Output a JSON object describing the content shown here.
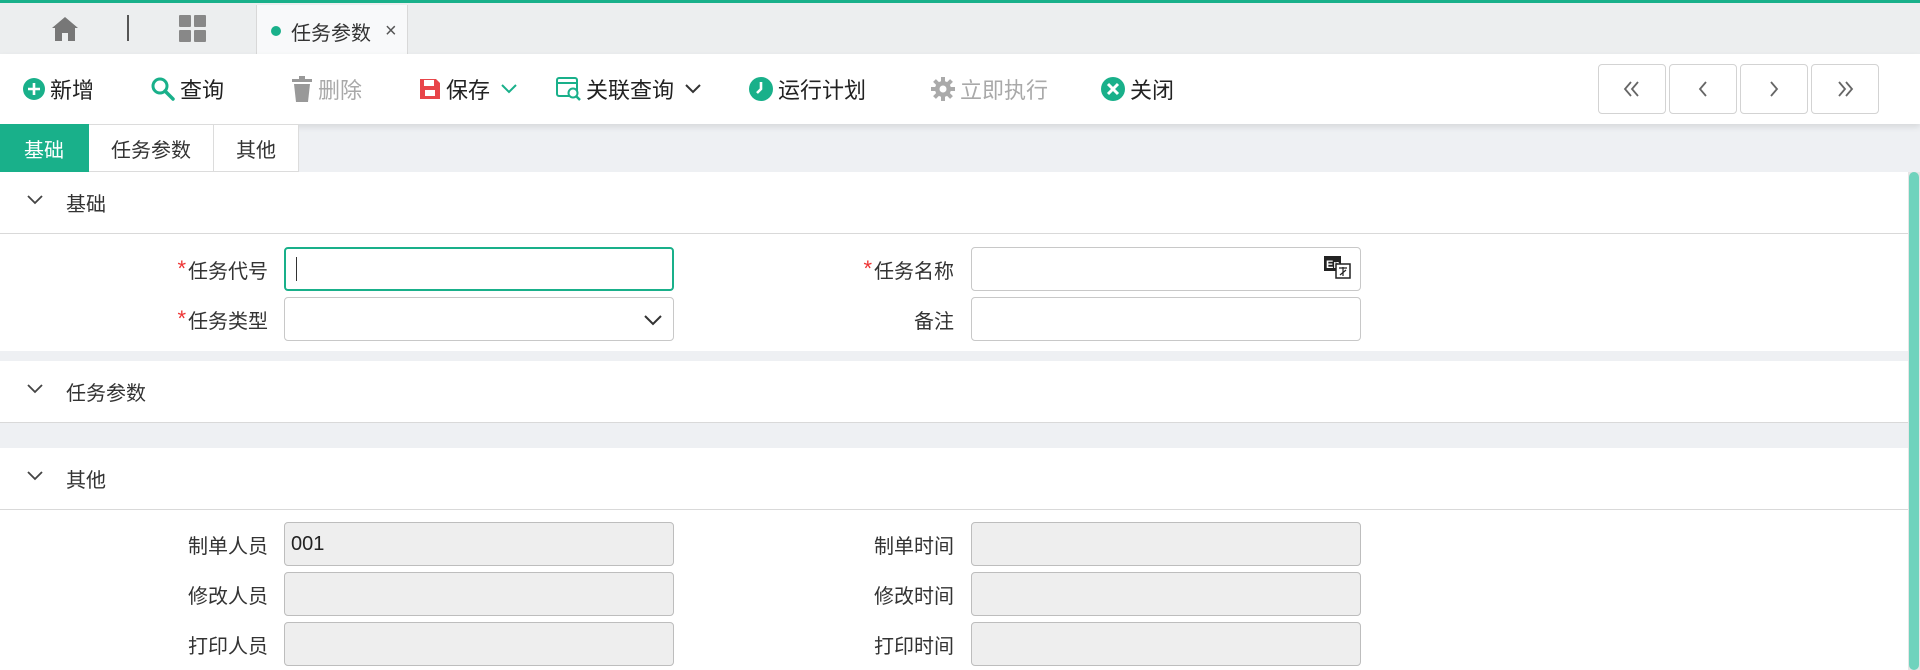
{
  "topbar": {
    "tab_label": "任务参数",
    "close_symbol": "×"
  },
  "toolbar": {
    "add": "新增",
    "query": "查询",
    "delete": "删除",
    "save": "保存",
    "related_query": "关联查询",
    "run_plan": "运行计划",
    "execute_now": "立即执行",
    "close": "关闭"
  },
  "subtabs": [
    "基础",
    "任务参数",
    "其他"
  ],
  "sections": {
    "basic": {
      "title": "基础",
      "task_code_label": "任务代号",
      "task_name_label": "任务名称",
      "task_type_label": "任务类型",
      "remark_label": "备注",
      "task_code_value": "",
      "task_name_value": "",
      "task_type_value": "",
      "remark_value": ""
    },
    "params": {
      "title": "任务参数"
    },
    "other": {
      "title": "其他",
      "creator_label": "制单人员",
      "creator_value": "001",
      "create_time_label": "制单时间",
      "create_time_value": "",
      "modifier_label": "修改人员",
      "modifier_value": "",
      "modify_time_label": "修改时间",
      "modify_time_value": "",
      "printer_label": "打印人员",
      "printer_value": "",
      "print_time_label": "打印时间",
      "print_time_value": ""
    }
  },
  "colors": {
    "accent": "#19b08a",
    "required": "#e33333",
    "save_icon": "#e8454a",
    "disabled": "#a9a9a9"
  },
  "icons": {
    "home": "home-icon",
    "apps": "grid-icon",
    "add": "plus-circle-icon",
    "query": "search-icon",
    "delete": "trash-icon",
    "save": "floppy-icon",
    "related_query": "related-search-icon",
    "run_plan": "clock-icon",
    "execute_now": "gear-icon",
    "close": "close-circle-icon",
    "translate": "translate-icon"
  }
}
